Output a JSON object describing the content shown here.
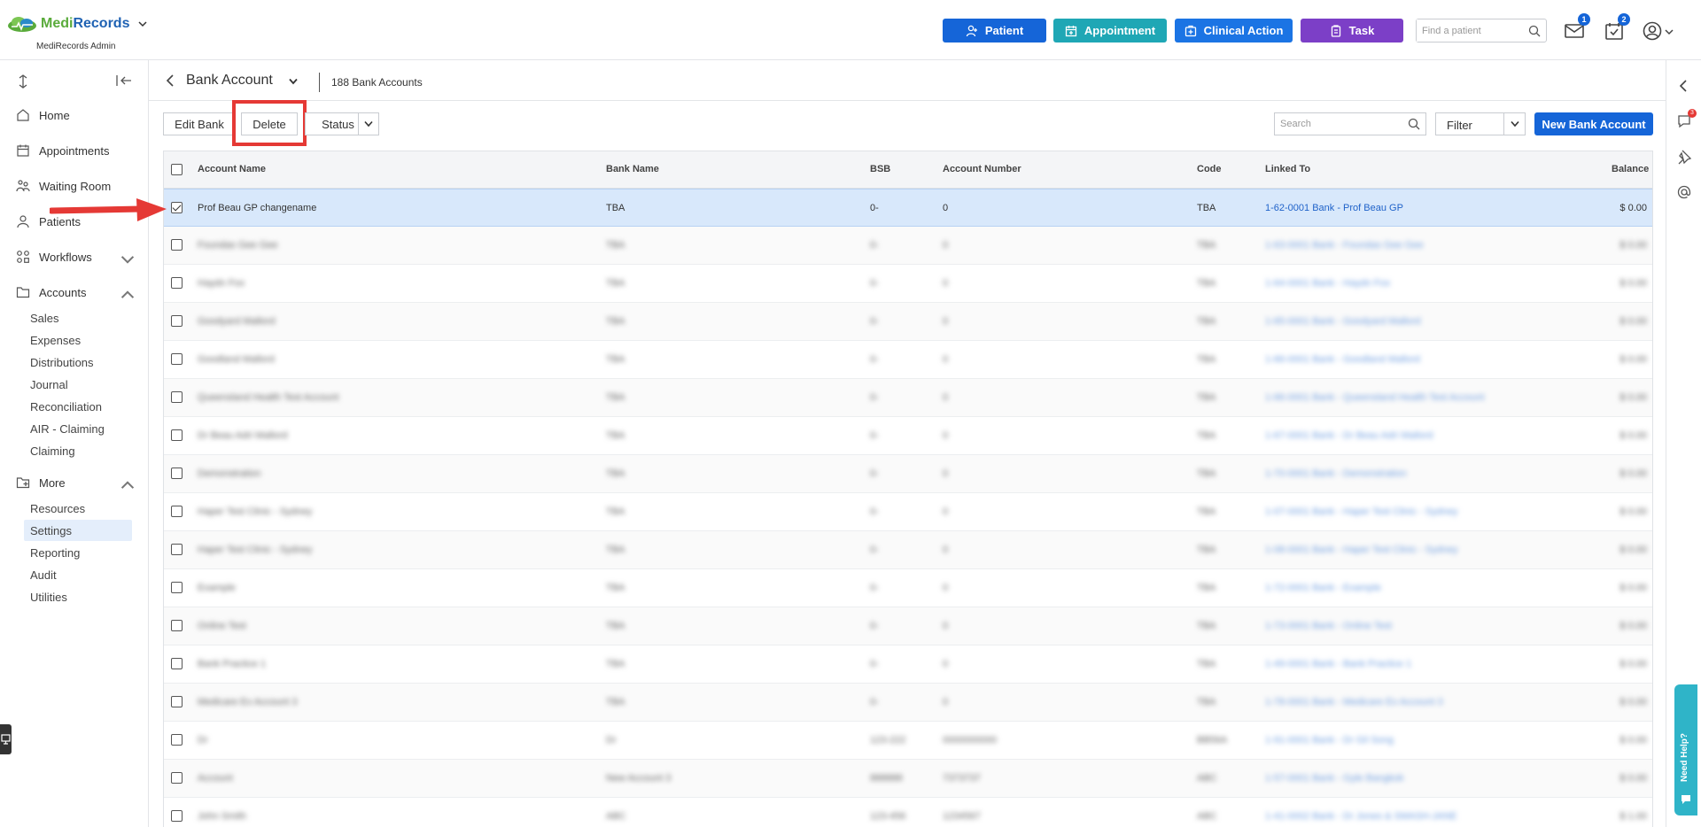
{
  "app": {
    "logo_medi": "Medi",
    "logo_records": "Records",
    "subtitle": "MediRecords Admin"
  },
  "header": {
    "buttons": [
      {
        "label": "Patient",
        "color": "#1565d8"
      },
      {
        "label": "Appointment",
        "color": "#1fa7b5"
      },
      {
        "label": "Clinical Action",
        "color": "#1b74e4"
      },
      {
        "label": "Task",
        "color": "#7c3fc7"
      }
    ],
    "search_placeholder": "Find a patient",
    "mail_badge": "1",
    "tasks_badge": "2"
  },
  "sidebar": {
    "items": [
      {
        "label": "Home"
      },
      {
        "label": "Appointments"
      },
      {
        "label": "Waiting Room"
      },
      {
        "label": "Patients"
      },
      {
        "label": "Workflows"
      },
      {
        "label": "Accounts"
      }
    ],
    "accounts_sub": [
      "Sales",
      "Expenses",
      "Distributions",
      "Journal",
      "Reconciliation",
      "AIR - Claiming",
      "Claiming"
    ],
    "more_label": "More",
    "more_sub": [
      "Resources",
      "Settings",
      "Reporting",
      "Audit",
      "Utilities"
    ],
    "active_sub": "Settings"
  },
  "main": {
    "title": "Bank Account",
    "count": "188 Bank Accounts",
    "toolbar": {
      "edit_label": "Edit Bank",
      "delete_label": "Delete",
      "status_label": "Status",
      "search_placeholder": "Search",
      "filter_label": "Filter",
      "new_label": "New Bank Account"
    },
    "columns": [
      "Account Name",
      "Bank Name",
      "BSB",
      "Account Number",
      "Code",
      "Linked To",
      "Balance"
    ],
    "rows": [
      {
        "name": "Prof Beau GP changename",
        "bank": "TBA",
        "bsb": "0-",
        "acct": "0",
        "code": "TBA",
        "linked": "1-62-0001 Bank - Prof Beau GP",
        "balance": "$ 0.00",
        "selected": true
      },
      {
        "name": "Foundas Gee Gee",
        "bank": "TBA",
        "bsb": "0-",
        "acct": "0",
        "code": "TBA",
        "linked": "1-63-0001 Bank - Foundas Gee Gee",
        "balance": "$ 0.00"
      },
      {
        "name": "Haydn Fox",
        "bank": "TBA",
        "bsb": "0-",
        "acct": "0",
        "code": "TBA",
        "linked": "1-64-0001 Bank - Haydn Fox",
        "balance": "$ 0.00"
      },
      {
        "name": "Goodyard Mallord",
        "bank": "TBA",
        "bsb": "0-",
        "acct": "0",
        "code": "TBA",
        "linked": "1-65-0001 Bank - Goodyard Mallord",
        "balance": "$ 0.00"
      },
      {
        "name": "Goodland Mallord",
        "bank": "TBA",
        "bsb": "0-",
        "acct": "0",
        "code": "TBA",
        "linked": "1-66-0001 Bank - Goodland Mallord",
        "balance": "$ 0.00"
      },
      {
        "name": "Queensland Health Test Account",
        "bank": "TBA",
        "bsb": "0-",
        "acct": "0",
        "code": "TBA",
        "linked": "1-66-0001 Bank - Queensland Health Test Account",
        "balance": "$ 0.00"
      },
      {
        "name": "Dr Beau Adri Mallord",
        "bank": "TBA",
        "bsb": "0-",
        "acct": "0",
        "code": "TBA",
        "linked": "1-67-0001 Bank - Dr Beau Adri Mallord",
        "balance": "$ 0.00"
      },
      {
        "name": "Demonstration",
        "bank": "TBA",
        "bsb": "0-",
        "acct": "0",
        "code": "TBA",
        "linked": "1-70-0001 Bank - Demonstration",
        "balance": "$ 0.00"
      },
      {
        "name": "Haper Test Clinic - Sydney",
        "bank": "TBA",
        "bsb": "0-",
        "acct": "0",
        "code": "TBA",
        "linked": "1-07-0001 Bank - Haper Test Clinic - Sydney",
        "balance": "$ 0.00"
      },
      {
        "name": "Haper Test Clinic - Sydney",
        "bank": "TBA",
        "bsb": "0-",
        "acct": "0",
        "code": "TBA",
        "linked": "1-08-0001 Bank - Haper Test Clinic - Sydney",
        "balance": "$ 0.00"
      },
      {
        "name": "Example",
        "bank": "TBA",
        "bsb": "0-",
        "acct": "0",
        "code": "TBA",
        "linked": "1-72-0001 Bank - Example",
        "balance": "$ 0.00"
      },
      {
        "name": "Online Test",
        "bank": "TBA",
        "bsb": "0-",
        "acct": "0",
        "code": "TBA",
        "linked": "1-73-0001 Bank - Online Test",
        "balance": "$ 0.00"
      },
      {
        "name": "Bank Practice 1",
        "bank": "TBA",
        "bsb": "0-",
        "acct": "0",
        "code": "TBA",
        "linked": "1-49-0001 Bank - Bank Practice 1",
        "balance": "$ 0.00"
      },
      {
        "name": "Medicare Ex Account 3",
        "bank": "TBA",
        "bsb": "0-",
        "acct": "0",
        "code": "TBA",
        "linked": "1-78-0001 Bank - Medicare Ex Account 3",
        "balance": "$ 0.00"
      },
      {
        "name": "Dr",
        "bank": "Dr",
        "bsb": "123-222",
        "acct": "0000000000",
        "code": "BB56A",
        "linked": "1-91-0001 Bank - Dr Gil Song",
        "balance": "$ 0.00"
      },
      {
        "name": "Account",
        "bank": "New Account 3",
        "bsb": "888888",
        "acct": "7373737",
        "code": "ABC",
        "linked": "1-57-0001 Bank - Gyle Bangkok",
        "balance": "$ 0.00"
      },
      {
        "name": "John Smith",
        "bank": "ABC",
        "bsb": "123-456",
        "acct": "1234567",
        "code": "ABC",
        "linked": "1-41-0002 Bank - Dr Jones & SMASH-JANE",
        "balance": "$ 1.00"
      }
    ]
  }
}
